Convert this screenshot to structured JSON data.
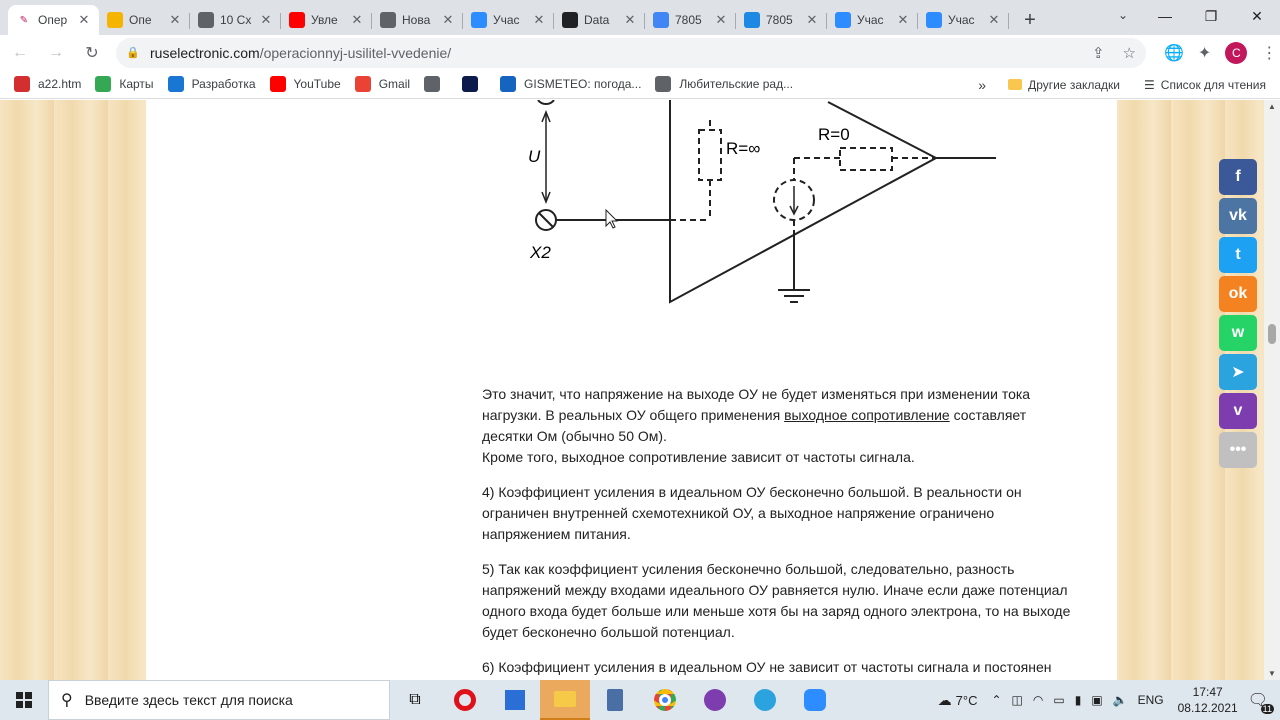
{
  "tabs": [
    {
      "title": "Опер",
      "color": "#ffffff",
      "active": true
    },
    {
      "title": "Опе",
      "color": "#f4b400"
    },
    {
      "title": "10 Сх",
      "color": "#5f6368"
    },
    {
      "title": "Увле",
      "color": "#ff0000"
    },
    {
      "title": "Нова",
      "color": "#5f6368"
    },
    {
      "title": "Учас",
      "color": "#2d8cff"
    },
    {
      "title": "Data",
      "color": "#202124"
    },
    {
      "title": "7805",
      "color": "#4285f4"
    },
    {
      "title": "7805",
      "color": "#1e88e5"
    },
    {
      "title": "Учас",
      "color": "#2d8cff"
    },
    {
      "title": "Учас",
      "color": "#2d8cff"
    }
  ],
  "address": {
    "host": "ruselectronic.com",
    "path": "/operacionnyj-usilitel-vvedenie/"
  },
  "profile_initial": "C",
  "bookmarks": [
    {
      "label": "a22.htm",
      "color": "#d32f2f"
    },
    {
      "label": "Карты",
      "color": "#34a853"
    },
    {
      "label": "Разработка",
      "color": "#1976d2"
    },
    {
      "label": "YouTube",
      "color": "#ff0000"
    },
    {
      "label": "Gmail",
      "color": "#ea4335"
    },
    {
      "label": "",
      "color": "#5f6368"
    },
    {
      "label": "",
      "color": "#0d1b4c"
    },
    {
      "label": "GISMETEO: погода...",
      "color": "#1565c0"
    },
    {
      "label": "Любительские рад...",
      "color": "#5f6368"
    }
  ],
  "bookmarks_more": "»",
  "bookmarks_right": {
    "other": "Другие закладки",
    "reading": "Список для чтения"
  },
  "diagram": {
    "u_label": "U",
    "x2_label": "X2",
    "r_inf": "R=∞",
    "r_zero": "R=0"
  },
  "article": {
    "p1_a": "Это значит, что напряжение на выходе ОУ не будет изменяться при изменении тока нагрузки. В реальных ОУ общего применения ",
    "p1_link": "выходное сопротивление",
    "p1_b": " составляет десятки Ом (обычно 50 Ом).",
    "p1_c": "Кроме того, выходное сопротивление зависит от частоты сигнала.",
    "p2": "4) Коэффициент усиления в идеальном ОУ бесконечно большой. В реальности он ограничен внутренней схемотехникой ОУ, а выходное напряжение ограничено напряжением питания.",
    "p3": "5) Так как коэффициент усиления  бесконечно большой, следовательно,  разность напряжений между входами идеального ОУ равняется нулю. Иначе если даже потенциал одного входа будет больше или меньше хотя бы на заряд одного электрона, то на выходе будет бесконечно большой потенциал.",
    "p4": "6) Коэффициент усиления в идеальном ОУ не зависит от частоты сигнала и постоянен"
  },
  "share_buttons": [
    {
      "name": "facebook",
      "glyph": "f",
      "color": "#3b5998"
    },
    {
      "name": "vk",
      "glyph": "vk",
      "color": "#4c75a3"
    },
    {
      "name": "twitter",
      "glyph": "t",
      "color": "#1da1f2"
    },
    {
      "name": "odnoklassniki",
      "glyph": "ok",
      "color": "#f58220"
    },
    {
      "name": "whatsapp",
      "glyph": "w",
      "color": "#25d366"
    },
    {
      "name": "telegram",
      "glyph": "➤",
      "color": "#2aa3df"
    },
    {
      "name": "viber",
      "glyph": "v",
      "color": "#7d3daf"
    },
    {
      "name": "more",
      "glyph": "•••",
      "color": "#c0c0c0"
    }
  ],
  "taskbar": {
    "search_placeholder": "Введите здесь текст для поиска",
    "weather": "7°C",
    "lang": "ENG",
    "time": "17:47",
    "date": "08.12.2021",
    "notif_count": "11"
  }
}
